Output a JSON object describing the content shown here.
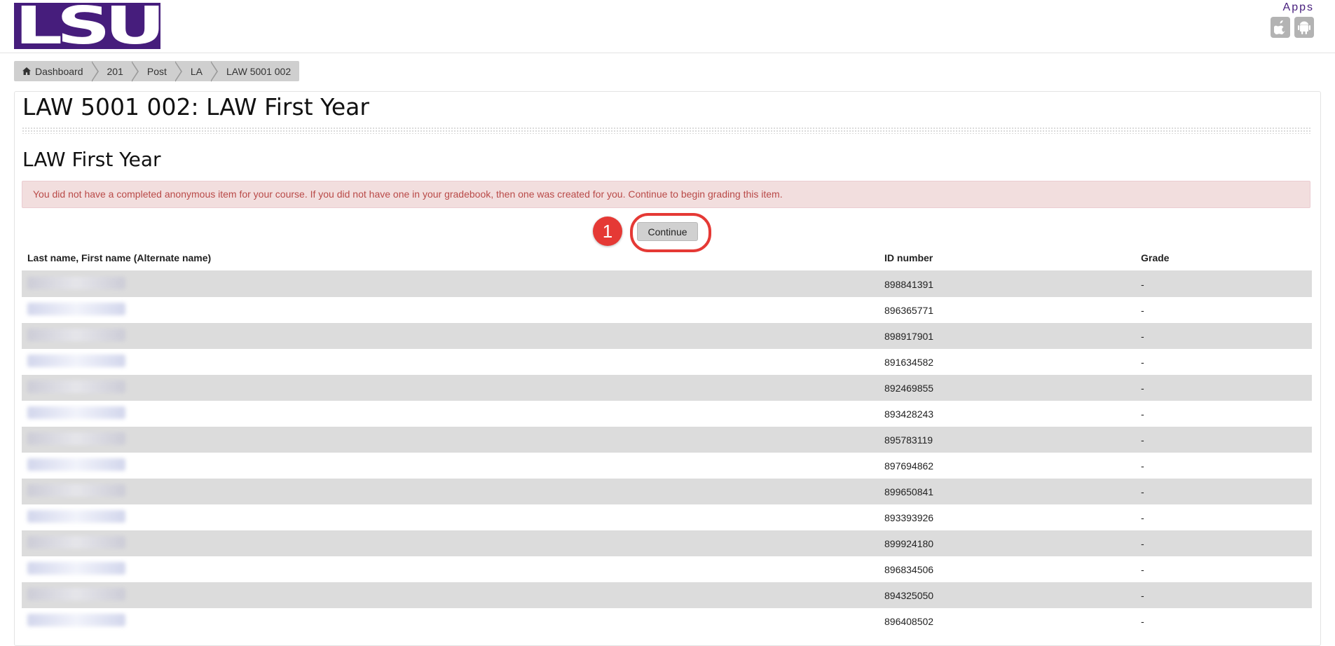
{
  "header": {
    "logo_text": "LSU",
    "apps_label": "Apps",
    "app_icons": [
      "apple-icon",
      "android-icon"
    ]
  },
  "breadcrumb": [
    {
      "label": "Dashboard",
      "icon": "home-icon"
    },
    {
      "label": "201"
    },
    {
      "label": "Post"
    },
    {
      "label": "LA"
    },
    {
      "label": "LAW 5001 002"
    }
  ],
  "page": {
    "course_title": "LAW 5001 002: LAW First Year",
    "section_title": "LAW First Year",
    "alert_text": "You did not have a completed anonymous item for your course. If you did not have one in your gradebook, then one was created for you. Continue to begin grading this item.",
    "step_number": "1",
    "continue_label": "Continue"
  },
  "table": {
    "headers": [
      "Last name, First name (Alternate name)",
      "ID number",
      "Grade"
    ],
    "rows": [
      {
        "id": "898841391",
        "grade": "-"
      },
      {
        "id": "896365771",
        "grade": "-"
      },
      {
        "id": "898917901",
        "grade": "-"
      },
      {
        "id": "891634582",
        "grade": "-"
      },
      {
        "id": "892469855",
        "grade": "-"
      },
      {
        "id": "893428243",
        "grade": "-"
      },
      {
        "id": "895783119",
        "grade": "-"
      },
      {
        "id": "897694862",
        "grade": "-"
      },
      {
        "id": "899650841",
        "grade": "-"
      },
      {
        "id": "893393926",
        "grade": "-"
      },
      {
        "id": "899924180",
        "grade": "-"
      },
      {
        "id": "896834506",
        "grade": "-"
      },
      {
        "id": "894325050",
        "grade": "-"
      },
      {
        "id": "896408502",
        "grade": "-"
      }
    ]
  },
  "colors": {
    "brand_purple": "#461d7c",
    "alert_bg": "#f2dede",
    "alert_text": "#b94a48",
    "highlight_red": "#e53935"
  }
}
